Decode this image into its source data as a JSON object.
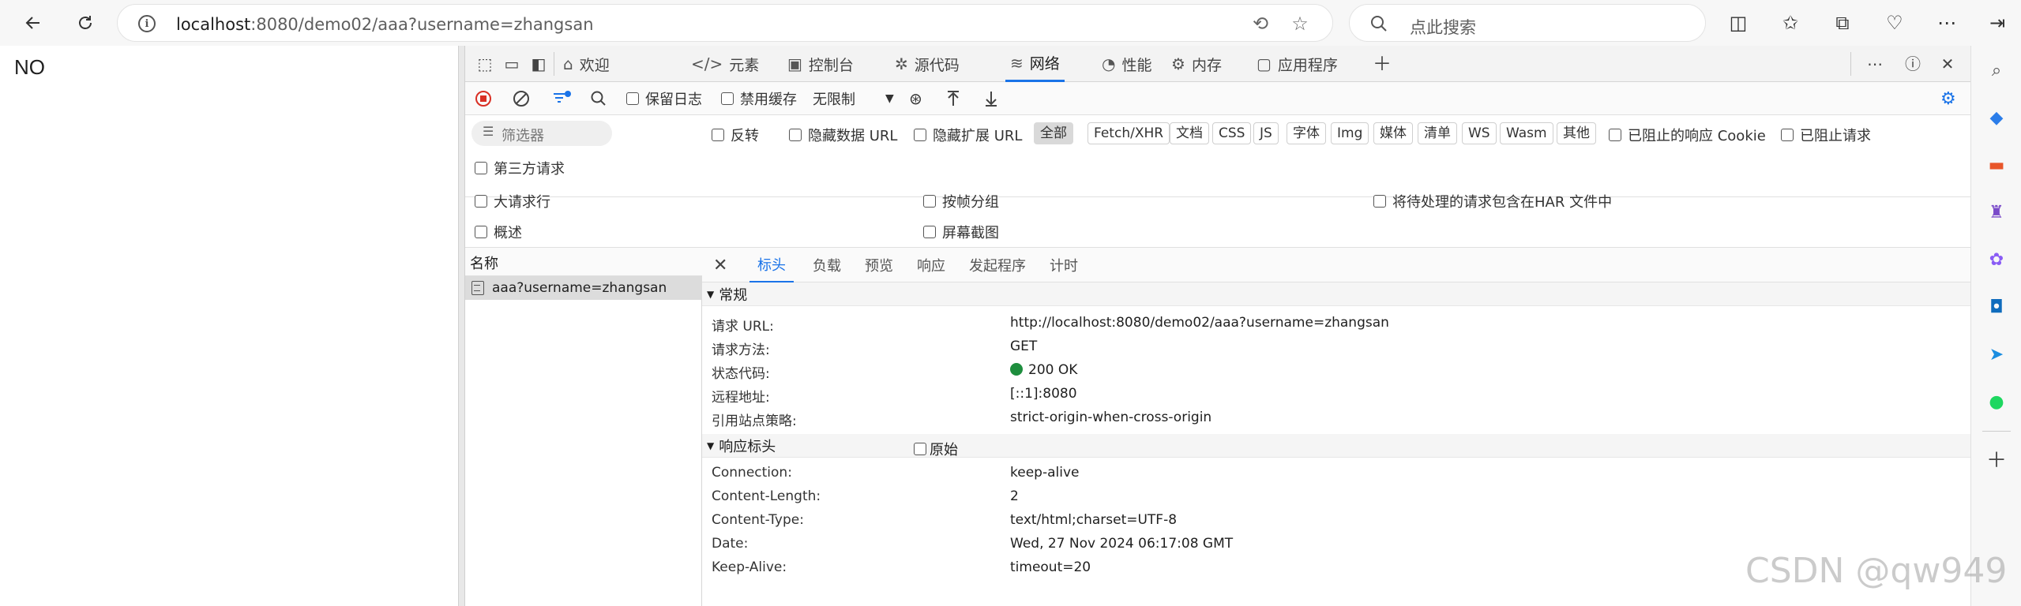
{
  "browser": {
    "url_host": "localhost",
    "url_rest": ":8080/demo02/aaa?username=zhangsan",
    "search_placeholder": "点此搜索"
  },
  "page": {
    "body_text": "NO"
  },
  "devtools": {
    "tabs": [
      {
        "label": "欢迎",
        "icon": "home-icon"
      },
      {
        "label": "元素",
        "icon": "code-icon"
      },
      {
        "label": "控制台",
        "icon": "console-icon"
      },
      {
        "label": "源代码",
        "icon": "bug-icon"
      },
      {
        "label": "网络",
        "icon": "wifi-icon"
      },
      {
        "label": "性能",
        "icon": "performance-icon"
      },
      {
        "label": "内存",
        "icon": "gear-icon"
      },
      {
        "label": "应用程序",
        "icon": "app-icon"
      }
    ],
    "toolbar": {
      "preserve_log": "保留日志",
      "disable_cache": "禁用缓存",
      "throttle": "无限制"
    },
    "filter": {
      "placeholder": "筛选器",
      "invert": "反转",
      "hide_data_url": "隐藏数据 URL",
      "hide_ext_url": "隐藏扩展 URL",
      "chips": [
        "全部",
        "Fetch/XHR",
        "文档",
        "CSS",
        "JS",
        "字体",
        "Img",
        "媒体",
        "清单",
        "WS",
        "Wasm",
        "其他"
      ],
      "blocked_cookie": "已阻止的响应 Cookie",
      "blocked_req": "已阻止请求",
      "third_party": "第三方请求"
    },
    "options": {
      "big_rows": "大请求行",
      "group_frame": "按帧分组",
      "pending_har": "将待处理的请求包含在HAR 文件中",
      "overview": "概述",
      "screenshots": "屏幕截图"
    },
    "list": {
      "header": "名称",
      "rows": [
        "aaa?username=zhangsan"
      ]
    },
    "detail": {
      "tabs": [
        "标头",
        "负载",
        "预览",
        "响应",
        "发起程序",
        "计时"
      ],
      "general": {
        "title": "常规",
        "rows": [
          {
            "k": "请求 URL:",
            "v": "http://localhost:8080/demo02/aaa?username=zhangsan"
          },
          {
            "k": "请求方法:",
            "v": "GET"
          },
          {
            "k": "状态代码:",
            "v": "200 OK"
          },
          {
            "k": "远程地址:",
            "v": "[::1]:8080"
          },
          {
            "k": "引用站点策略:",
            "v": "strict-origin-when-cross-origin"
          }
        ]
      },
      "response": {
        "title": "响应标头",
        "raw_label": "原始",
        "rows": [
          {
            "k": "Connection:",
            "v": "keep-alive"
          },
          {
            "k": "Content-Length:",
            "v": "2"
          },
          {
            "k": "Content-Type:",
            "v": "text/html;charset=UTF-8"
          },
          {
            "k": "Date:",
            "v": "Wed, 27 Nov 2024 06:17:08 GMT"
          },
          {
            "k": "Keep-Alive:",
            "v": "timeout=20"
          }
        ]
      }
    }
  },
  "watermark": "CSDN @qw949",
  "colors": {
    "accent": "#1a73e8",
    "status_ok": "#1e8e3e",
    "record": "#d93025"
  }
}
